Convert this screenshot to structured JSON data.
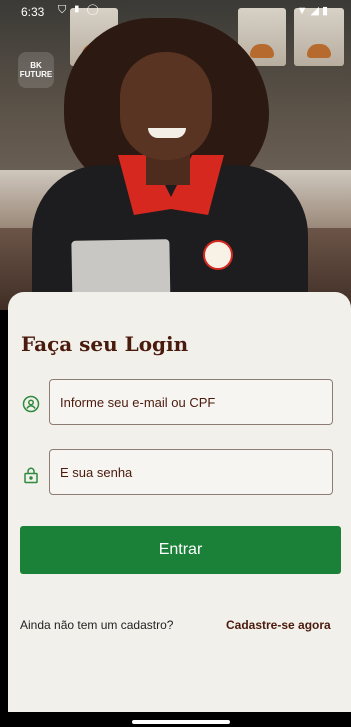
{
  "status_bar": {
    "time": "6:33",
    "icons_left": [
      "shield-icon",
      "sim-icon",
      "circle-icon"
    ],
    "icons_right": [
      "wifi-icon",
      "signal-icon",
      "battery-icon"
    ]
  },
  "brand": {
    "logo_text": "BK FUTURE"
  },
  "login": {
    "title": "Faça seu Login",
    "email_placeholder": "Informe seu e-mail ou CPF",
    "password_placeholder": "E sua senha",
    "submit_label": "Entrar",
    "register_prompt": "Ainda não tem um cadastro?",
    "register_link": "Cadastre-se agora"
  },
  "colors": {
    "accent_green": "#1b8038",
    "title_brown": "#4a1a0d",
    "card_background": "#f2f0eb"
  }
}
